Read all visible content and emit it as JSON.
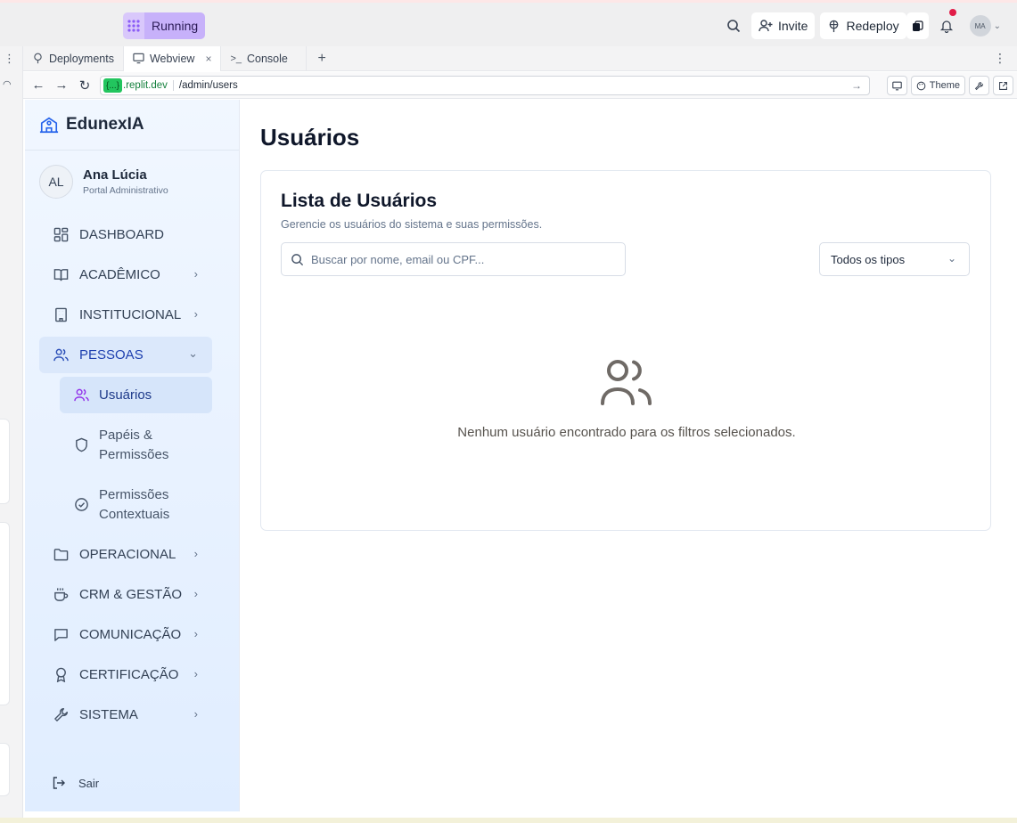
{
  "topbar": {
    "status_label": "Running",
    "invite_label": "Invite",
    "redeploy_label": "Redeploy",
    "avatar_initials": "MA"
  },
  "tabs": [
    {
      "label": "Deployments",
      "icon": "deploy-icon",
      "active": false
    },
    {
      "label": "Webview",
      "icon": "monitor-icon",
      "active": true,
      "close": "×"
    },
    {
      "label": "Console",
      "icon": "terminal-icon",
      "active": false
    }
  ],
  "tab_add": "+",
  "address": {
    "badge": "{...}",
    "domain": ".replit.dev",
    "path": "/admin/users",
    "theme_label": "Theme"
  },
  "sidebar": {
    "brand": "EdunexIA",
    "user": {
      "initials": "AL",
      "name": "Ana Lúcia",
      "role": "Portal Administrativo"
    },
    "items": [
      {
        "label": "DASHBOARD",
        "icon": "grid-icon"
      },
      {
        "label": "ACADÊMICO",
        "icon": "book-icon"
      },
      {
        "label": "INSTITUCIONAL",
        "icon": "building-icon"
      },
      {
        "label": "PESSOAS",
        "icon": "users-icon"
      },
      {
        "label": "OPERACIONAL",
        "icon": "folder-icon"
      },
      {
        "label": "CRM & GESTÃO",
        "icon": "coffee-icon"
      },
      {
        "label": "COMUNICAÇÃO",
        "icon": "message-icon"
      },
      {
        "label": "CERTIFICAÇÃO",
        "icon": "award-icon"
      },
      {
        "label": "SISTEMA",
        "icon": "wrench-icon"
      }
    ],
    "subitems": [
      {
        "label": "Usuários",
        "icon": "users-icon"
      },
      {
        "label": "Papéis & Permissões",
        "icon": "shield-icon"
      },
      {
        "label": "Permissões Contextuais",
        "icon": "check-circle-icon"
      }
    ],
    "logout_label": "Sair"
  },
  "main": {
    "title": "Usuários",
    "card": {
      "title": "Lista de Usuários",
      "subtitle": "Gerencie os usuários do sistema e suas permissões.",
      "search_placeholder": "Buscar por nome, email ou CPF...",
      "filter_value": "Todos os tipos",
      "empty_message": "Nenhum usuário encontrado para os filtros selecionados."
    }
  }
}
